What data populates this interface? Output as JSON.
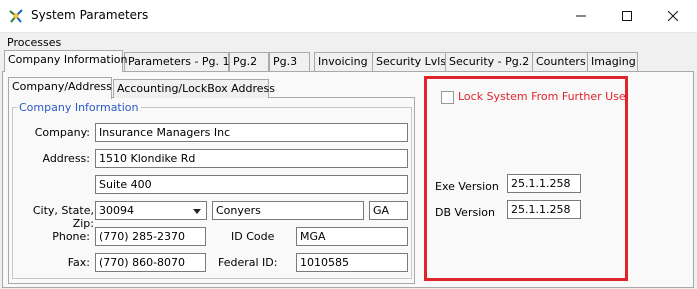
{
  "window": {
    "title": "System Parameters"
  },
  "menu": {
    "processes": "Processes"
  },
  "tabs": [
    "Company Information",
    "Parameters - Pg. 1",
    "Pg.2",
    "Pg.3",
    "Invoicing",
    "Security Lvls",
    "Security - Pg.2",
    "Counters",
    "Imaging"
  ],
  "subtabs": [
    "Company/Address",
    "Accounting/LockBox Address"
  ],
  "group": {
    "label": "Company Information"
  },
  "company": {
    "company_label": "Company:",
    "company_value": "Insurance Managers Inc",
    "address_label": "Address:",
    "address1": "1510 Klondike Rd",
    "address2": "Suite 400",
    "csz_label": "City, State, Zip:",
    "zip": "30094",
    "city": "Conyers",
    "state": "GA",
    "phone_label": "Phone:",
    "phone": "(770) 285-2370",
    "idcode_label": "ID Code",
    "idcode": "MGA",
    "fax_label": "Fax:",
    "fax": "(770) 860-8070",
    "federal_label": "Federal ID:",
    "federal": "1010585"
  },
  "lock": {
    "label": "Lock System From Further Use",
    "checked": false
  },
  "versions": {
    "exe_label": "Exe Version",
    "exe_value": "25.1.1.258",
    "db_label": "DB Version",
    "db_value": "25.1.1.258"
  },
  "colors": {
    "highlight": "#e0242b",
    "group_label": "#2b59c3"
  }
}
